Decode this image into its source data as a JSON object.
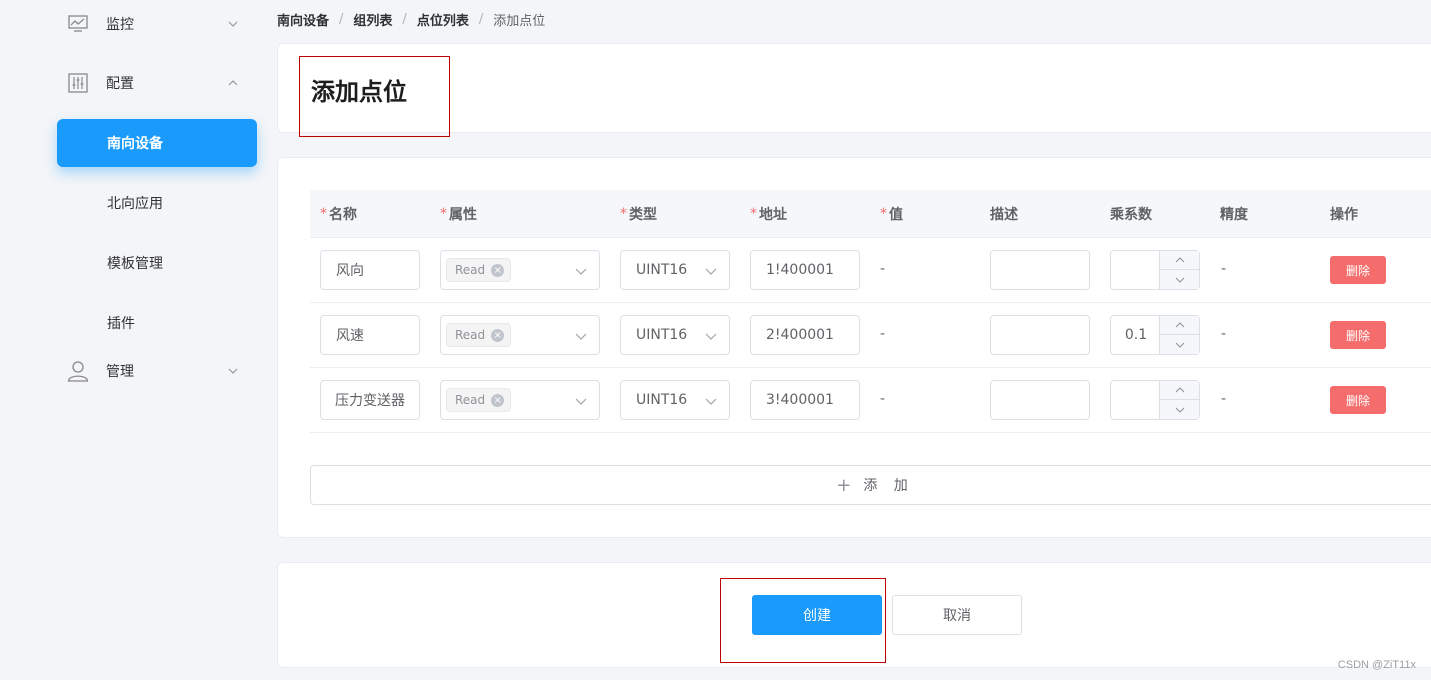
{
  "sidebar": {
    "monitor": {
      "label": "监控",
      "icon": "monitor-chart-icon"
    },
    "config": {
      "label": "配置",
      "icon": "config-sliders-icon"
    },
    "config_items": [
      {
        "label": "南向设备",
        "active": true
      },
      {
        "label": "北向应用",
        "active": false
      },
      {
        "label": "模板管理",
        "active": false
      },
      {
        "label": "插件",
        "active": false
      }
    ],
    "manage": {
      "label": "管理",
      "icon": "user-icon"
    }
  },
  "breadcrumb": [
    "南向设备",
    "组列表",
    "点位列表",
    "添加点位"
  ],
  "page_title": "添加点位",
  "table": {
    "headers": {
      "name": "名称",
      "attribute": "属性",
      "type": "类型",
      "address": "地址",
      "value": "值",
      "description": "描述",
      "multiplier": "乘系数",
      "precision": "精度",
      "action": "操作"
    },
    "required_mark": "*",
    "rows": [
      {
        "name": "风向",
        "attribute": "Read",
        "type": "UINT16",
        "address": "1!400001",
        "value": "-",
        "description": "",
        "multiplier": "",
        "precision": "-",
        "action": "删除"
      },
      {
        "name": "风速",
        "attribute": "Read",
        "type": "UINT16",
        "address": "2!400001",
        "value": "-",
        "description": "",
        "multiplier": "0.1",
        "precision": "-",
        "action": "删除"
      },
      {
        "name": "压力变送器",
        "attribute": "Read",
        "type": "UINT16",
        "address": "3!400001",
        "value": "-",
        "description": "",
        "multiplier": "",
        "precision": "-",
        "action": "删除"
      }
    ]
  },
  "add_button": "添 加",
  "create_button": "创建",
  "cancel_button": "取消",
  "watermark": "CSDN @ZiT11x",
  "colors": {
    "primary": "#1a9bfc",
    "danger": "#f56c6c",
    "highlight_box": "#c00000"
  }
}
